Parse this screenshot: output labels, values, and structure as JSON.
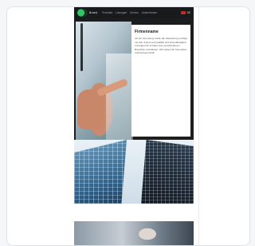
{
  "header": {
    "brand": "Brand",
    "nav": [
      "Produkte",
      "Lösungen",
      "Service",
      "Unternehmen"
    ],
    "lang": "DE"
  },
  "hero": {
    "title": "Firmenname",
    "paragraph": "Ab der Gründung wurde die Zielsetzung verfolgt, mit dem Fokus auf Qualität und Zuverlässigkeit Lösungen für Kunden aus verschiedenen Branchen anzubieten. Wir stehen für Innovation und Partnerschaft."
  },
  "icons": {
    "logo": "logo-icon",
    "flag": "flag-icon"
  },
  "colors": {
    "hero_background": "#1b1d1f",
    "page_background": "#f4f6f8",
    "logo_green": "#35c46a"
  }
}
